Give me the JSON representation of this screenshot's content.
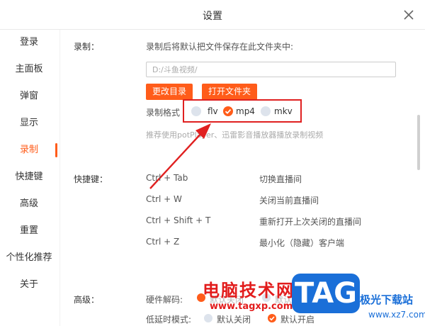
{
  "window": {
    "title": "设置"
  },
  "sidebar": {
    "items": [
      {
        "label": "登录"
      },
      {
        "label": "主面板"
      },
      {
        "label": "弹窗"
      },
      {
        "label": "显示"
      },
      {
        "label": "录制"
      },
      {
        "label": "快捷键"
      },
      {
        "label": "高级"
      },
      {
        "label": "重置"
      },
      {
        "label": "个性化推荐"
      },
      {
        "label": "关于"
      }
    ],
    "active": "录制"
  },
  "record": {
    "section_label": "录制：",
    "desc": "录制后将默认把文件保存在此文件夹中:",
    "path_placeholder": "D:/斗鱼视频/",
    "change_dir_label": "更改目录",
    "open_folder_label": "打开文件夹",
    "format_label": "录制格式",
    "formats": [
      {
        "label": "flv",
        "checked": false
      },
      {
        "label": "mp4",
        "checked": true
      },
      {
        "label": "mkv",
        "checked": false
      }
    ],
    "hint": "推荐使用potPlayer、迅雷影音播放器播放录制视频"
  },
  "shortcuts": {
    "section_label": "快捷键：",
    "rows": [
      {
        "keys": "Ctrl + Tab",
        "action": "切换直播间"
      },
      {
        "keys": "Ctrl + W",
        "action": "关闭当前直播间"
      },
      {
        "keys": "Ctrl + Shift + T",
        "action": "重新打开上次关闭的直播间"
      },
      {
        "keys": "Ctrl + Z",
        "action": "最小化（隐藏）客户端"
      }
    ]
  },
  "advanced": {
    "section_label": "高级：",
    "hw_decode_label": "硬件解码:",
    "hw_off": "默认关闭",
    "hw_on": "默认",
    "low_latency_label": "低延时模式:",
    "ll_off": "默认关闭",
    "ll_on": "默认开启"
  },
  "watermark": {
    "cn_text": "电脑技术网",
    "url": "www.tagxp.com",
    "tag": "TAG",
    "site_name": "极光下载站",
    "site_url": "www.xz7.com"
  },
  "colors": {
    "accent": "#ff5c1a",
    "annotation": "#e02020"
  }
}
